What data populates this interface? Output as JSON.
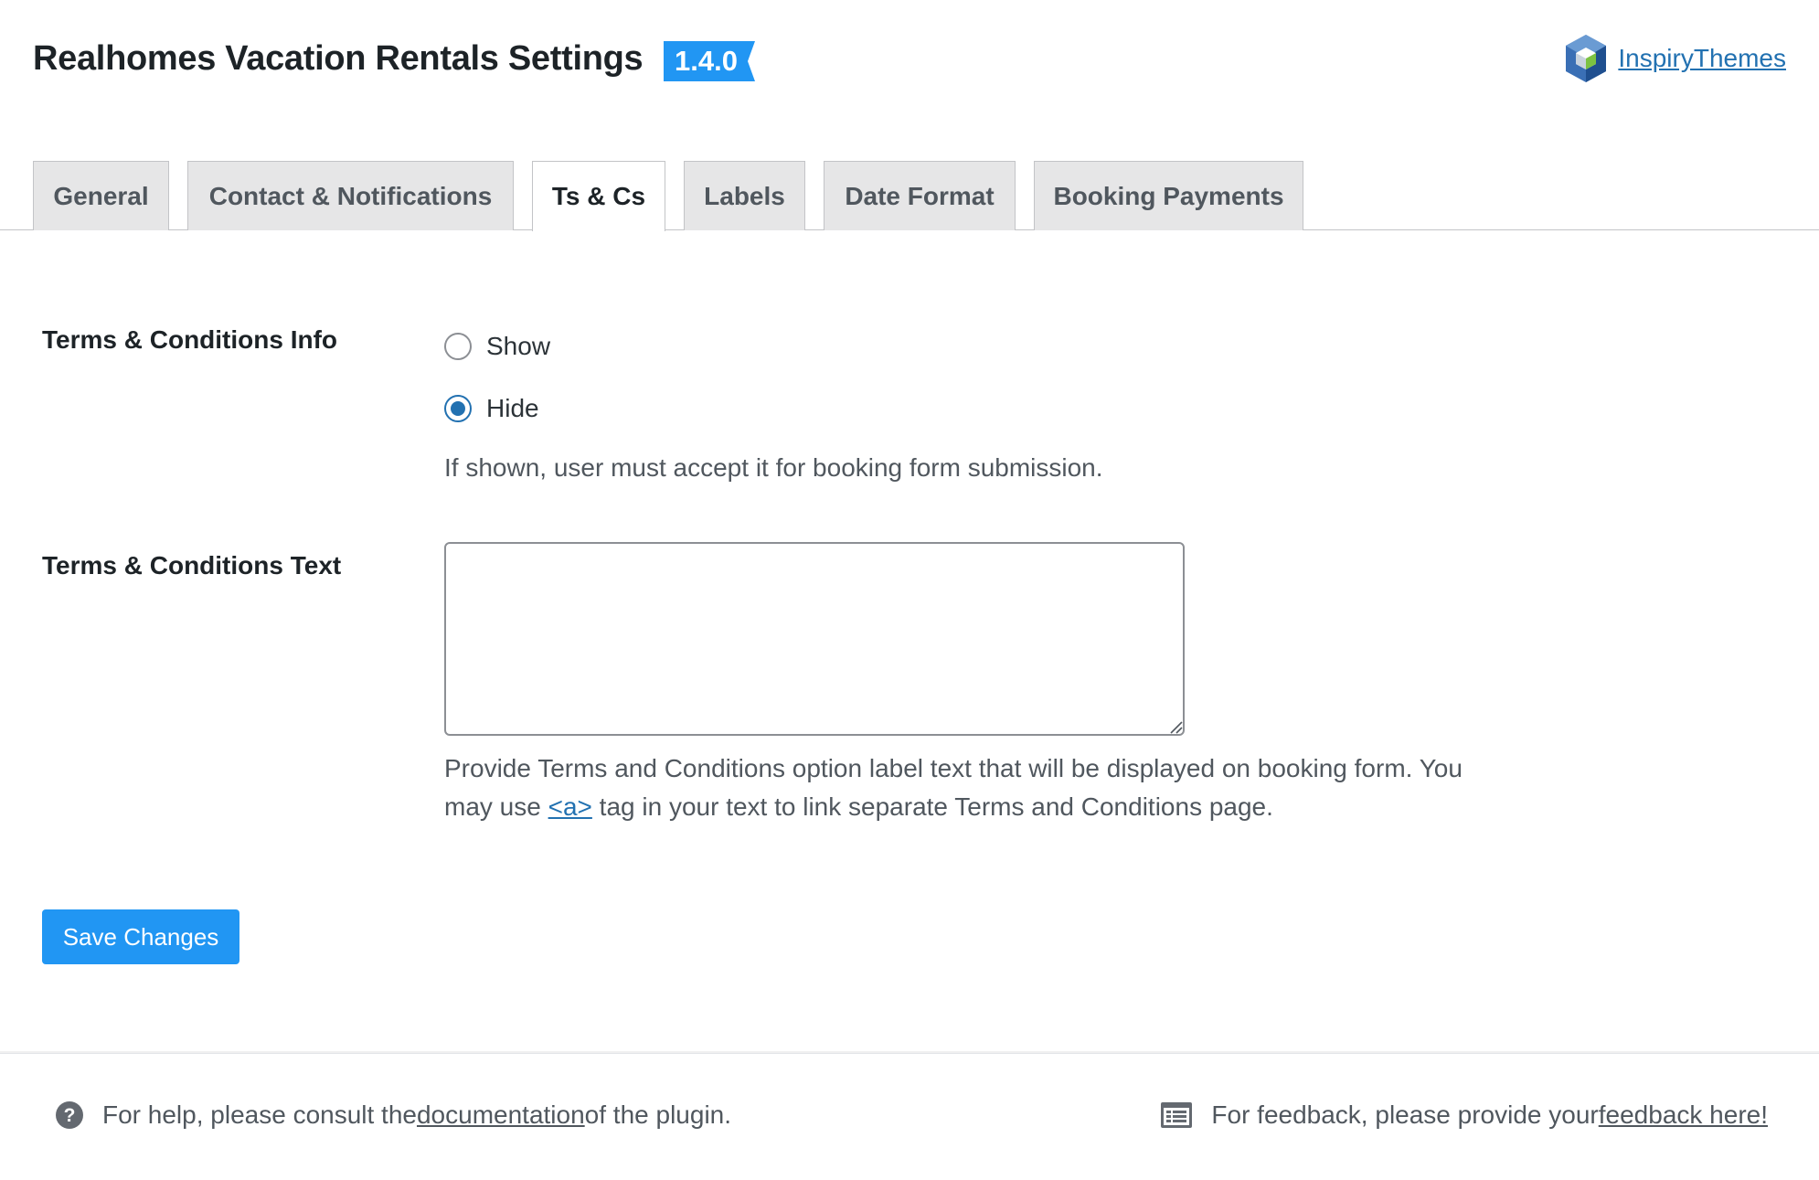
{
  "header": {
    "title": "Realhomes Vacation Rentals Settings",
    "version": "1.4.0",
    "brand_link": "InspiryThemes"
  },
  "tabs": [
    {
      "label": "General",
      "active": false
    },
    {
      "label": "Contact & Notifications",
      "active": false
    },
    {
      "label": "Ts & Cs",
      "active": true
    },
    {
      "label": "Labels",
      "active": false
    },
    {
      "label": "Date Format",
      "active": false
    },
    {
      "label": "Booking Payments",
      "active": false
    }
  ],
  "settings": {
    "tc_info": {
      "label": "Terms & Conditions Info",
      "options": [
        {
          "label": "Show",
          "checked": false
        },
        {
          "label": "Hide",
          "checked": true
        }
      ],
      "description": "If shown, user must accept it for booking form submission."
    },
    "tc_text": {
      "label": "Terms & Conditions Text",
      "value": "",
      "description_part1": "Provide Terms and Conditions option label text that will be displayed on booking form. You",
      "description_part2_prefix": "may use ",
      "description_link": "<a>",
      "description_part2_suffix": " tag in your text to link separate Terms and Conditions page."
    }
  },
  "save_button": "Save Changes",
  "footer": {
    "help_prefix": "For help, please consult the ",
    "help_link": "documentation ",
    "help_suffix": "of the plugin.",
    "feedback_prefix": "For feedback, please provide your ",
    "feedback_link": "feedback here!"
  },
  "colors": {
    "accent": "#2196f3",
    "link": "#2271b1"
  }
}
